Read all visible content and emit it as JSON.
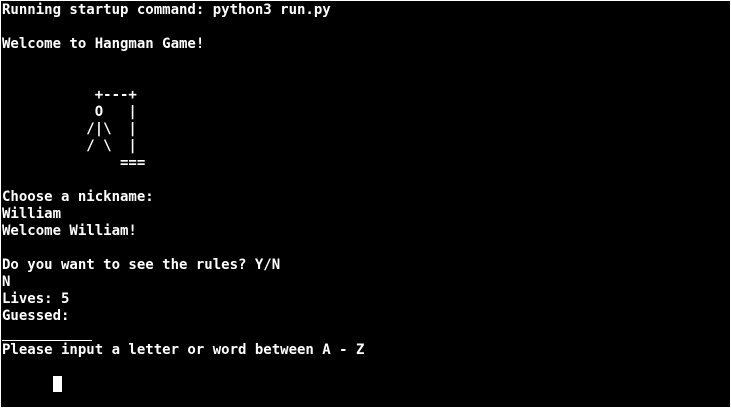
{
  "terminal": {
    "startup_line": "Running startup command: python3 run.py",
    "welcome": "Welcome to Hangman Game!",
    "hangman_art": "           +---+\n           O   |\n          /|\\  |\n          / \\  |\n              ===",
    "nickname_prompt": "Choose a nickname:",
    "nickname_input": "William",
    "welcome_user": "Welcome William!",
    "rules_prompt": "Do you want to see the rules? Y/N",
    "rules_answer": "N",
    "lives_line": "Lives: 5",
    "guessed_line": "Guessed:",
    "input_prompt": "Please input a letter or word between A - Z"
  },
  "colors": {
    "background": "#000000",
    "foreground": "#ffffff"
  }
}
